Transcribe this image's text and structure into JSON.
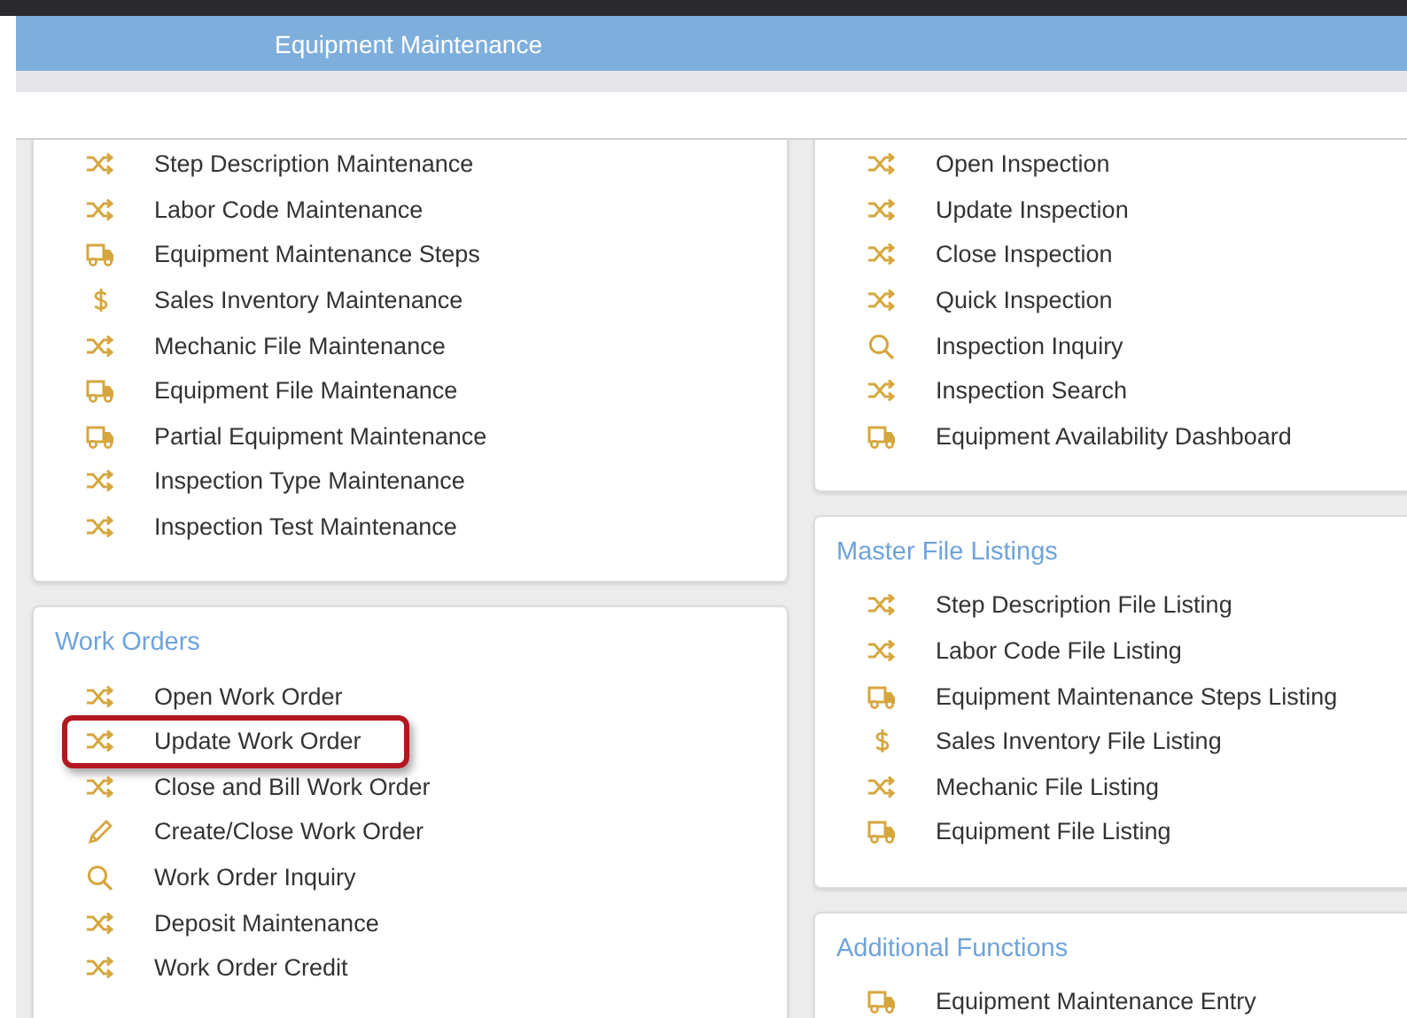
{
  "header": {
    "title": "Equipment Maintenance"
  },
  "columns": [
    [
      {
        "items": [
          {
            "label": "Step Description Maintenance",
            "kind": "shuffle"
          },
          {
            "label": "Labor Code Maintenance",
            "kind": "shuffle"
          },
          {
            "label": "Equipment Maintenance Steps",
            "kind": "truck"
          },
          {
            "label": "Sales Inventory Maintenance",
            "kind": "dollar"
          },
          {
            "label": "Mechanic File Maintenance",
            "kind": "shuffle"
          },
          {
            "label": "Equipment File Maintenance",
            "kind": "truck"
          },
          {
            "label": "Partial Equipment Maintenance",
            "kind": "truck"
          },
          {
            "label": "Inspection Type Maintenance",
            "kind": "shuffle"
          },
          {
            "label": "Inspection Test Maintenance",
            "kind": "shuffle"
          }
        ]
      },
      {
        "title": "Work Orders",
        "items": [
          {
            "label": "Open Work Order",
            "kind": "shuffle",
            "highlighted": false
          },
          {
            "label": "Update Work Order",
            "kind": "shuffle",
            "highlighted": true
          },
          {
            "label": "Close and Bill Work Order",
            "kind": "shuffle",
            "highlighted": false
          },
          {
            "label": "Create/Close Work Order",
            "kind": "pencil",
            "highlighted": false
          },
          {
            "label": "Work Order Inquiry",
            "kind": "search",
            "highlighted": false
          },
          {
            "label": "Deposit Maintenance",
            "kind": "shuffle",
            "highlighted": false
          },
          {
            "label": "Work Order Credit",
            "kind": "shuffle",
            "highlighted": false
          }
        ]
      }
    ],
    [
      {
        "items": [
          {
            "label": "Open Inspection",
            "kind": "shuffle"
          },
          {
            "label": "Update Inspection",
            "kind": "shuffle"
          },
          {
            "label": "Close Inspection",
            "kind": "shuffle"
          },
          {
            "label": "Quick Inspection",
            "kind": "shuffle"
          },
          {
            "label": "Inspection Inquiry",
            "kind": "search"
          },
          {
            "label": "Inspection Search",
            "kind": "shuffle"
          },
          {
            "label": "Equipment Availability Dashboard",
            "kind": "truck"
          }
        ]
      },
      {
        "title": "Master File Listings",
        "items": [
          {
            "label": "Step Description File Listing",
            "kind": "shuffle"
          },
          {
            "label": "Labor Code File Listing",
            "kind": "shuffle"
          },
          {
            "label": "Equipment Maintenance Steps Listing",
            "kind": "truck"
          },
          {
            "label": "Sales Inventory File Listing",
            "kind": "dollar"
          },
          {
            "label": "Mechanic File Listing",
            "kind": "shuffle"
          },
          {
            "label": "Equipment File Listing",
            "kind": "truck"
          }
        ]
      },
      {
        "title": "Additional Functions",
        "items": [
          {
            "label": "Equipment Maintenance Entry",
            "kind": "truck"
          }
        ]
      }
    ]
  ]
}
